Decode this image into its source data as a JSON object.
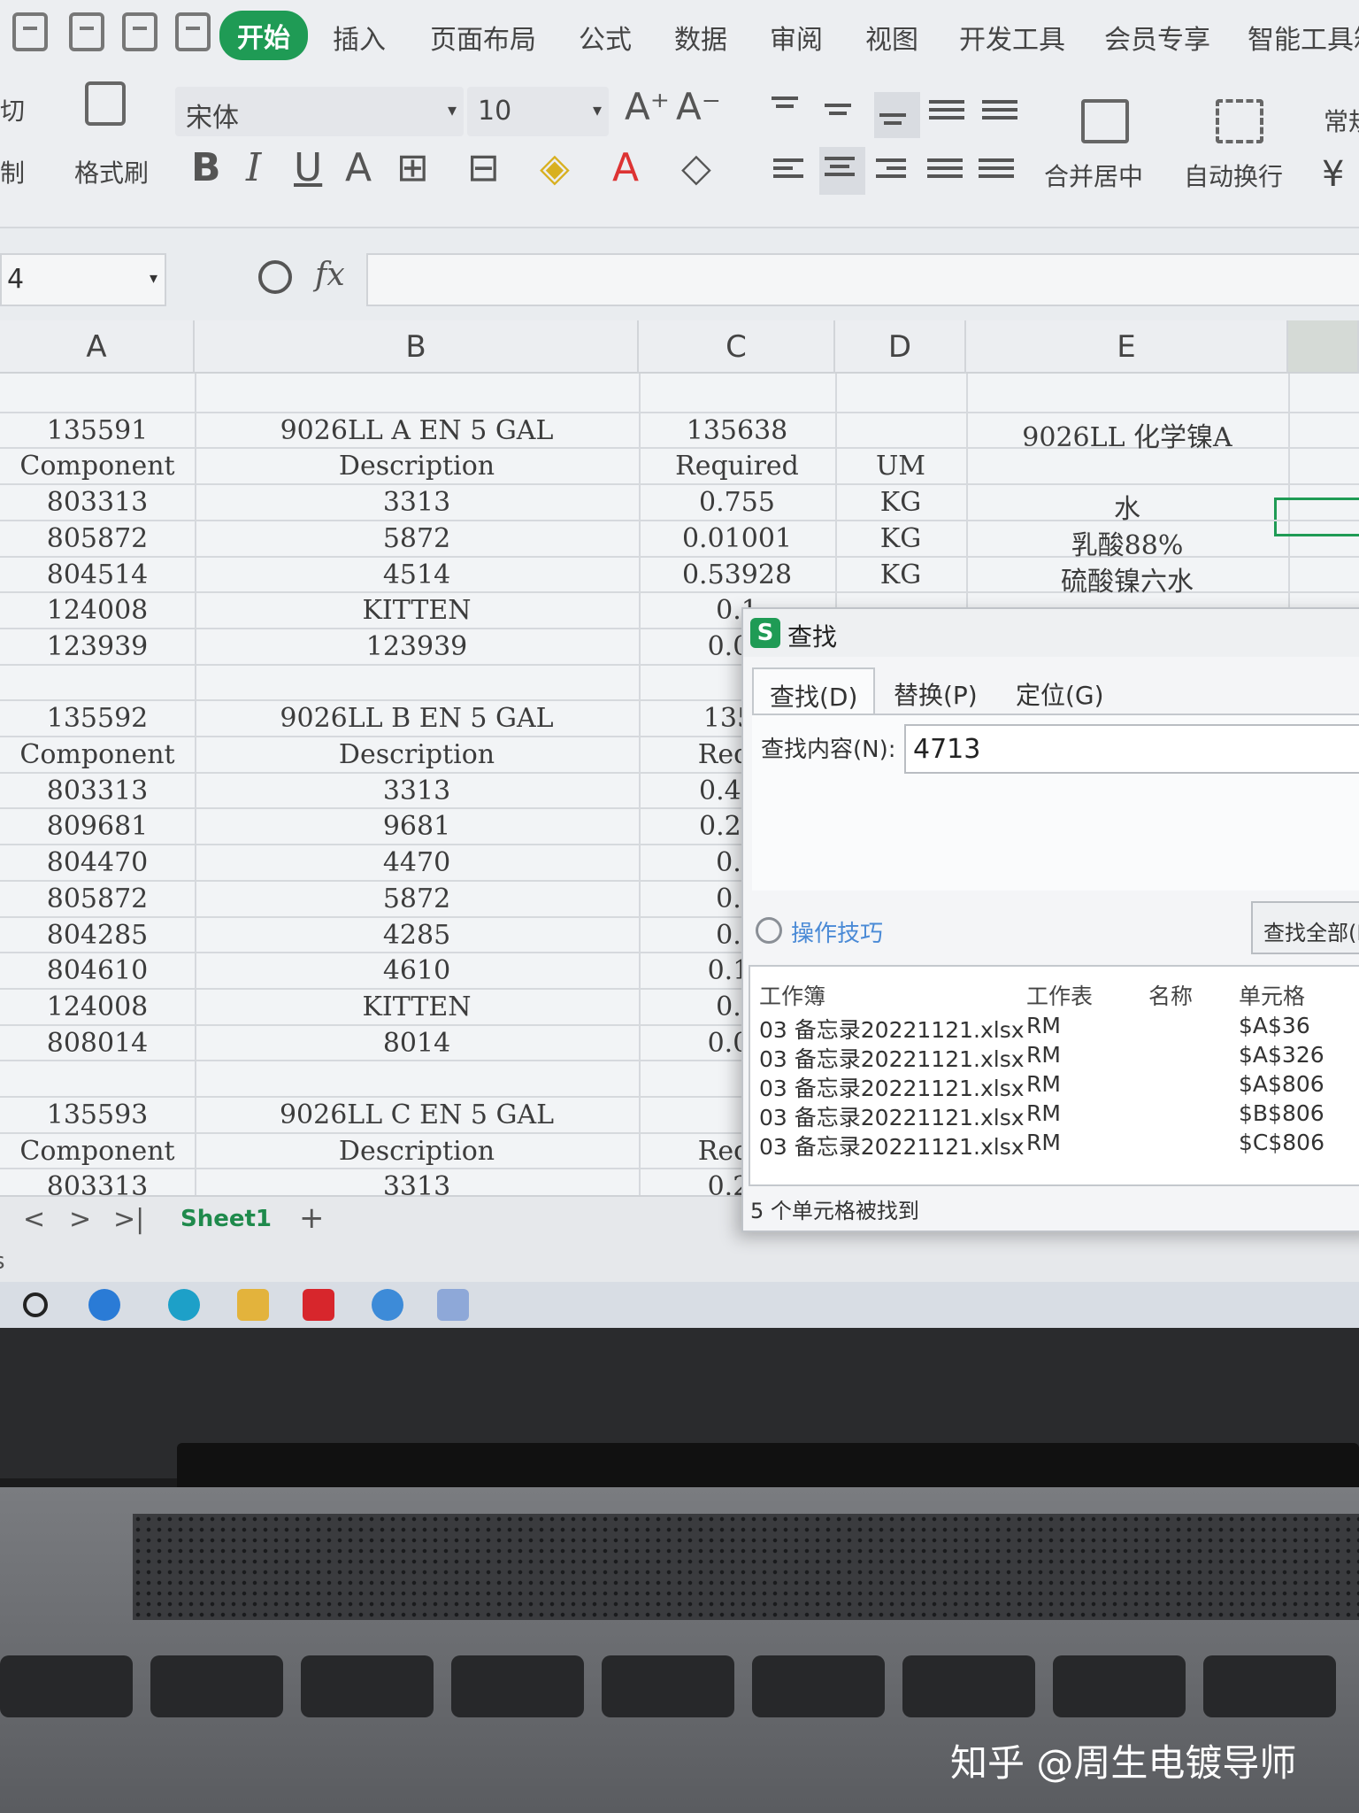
{
  "menu": {
    "tabs": [
      "开始",
      "插入",
      "页面布局",
      "公式",
      "数据",
      "审阅",
      "视图",
      "开发工具",
      "会员专享",
      "智能工具箱"
    ],
    "active_tab": "开始"
  },
  "ribbon": {
    "cut_label": "剪切",
    "copy_label": "复制",
    "format_painter_label": "格式刷",
    "font_name": "宋体",
    "font_size": "10",
    "merge_label": "合并居中",
    "wrap_label": "自动换行",
    "number_format": "常规",
    "currency_symbol": "¥"
  },
  "formula_bar": {
    "name_box": "4",
    "fx_label": "fx",
    "content": ""
  },
  "grid": {
    "columns": [
      "A",
      "B",
      "C",
      "D",
      "E"
    ],
    "rows": [
      {
        "a": "",
        "b": "",
        "c": "",
        "d": "",
        "e": ""
      },
      {
        "a": "135591",
        "b": "9026LL A EN 5 GAL",
        "c": "135638",
        "d": "",
        "e": "9026LL 化学镍A"
      },
      {
        "a": "Component",
        "b": "Description",
        "c": "Required",
        "d": "UM",
        "e": ""
      },
      {
        "a": "803313",
        "b": "3313",
        "c": "0.755",
        "d": "KG",
        "e": "水"
      },
      {
        "a": "805872",
        "b": "5872",
        "c": "0.01001",
        "d": "KG",
        "e": "乳酸88%"
      },
      {
        "a": "804514",
        "b": "4514",
        "c": "0.53928",
        "d": "KG",
        "e": "硫酸镍六水"
      },
      {
        "a": "124008",
        "b": "KITTEN",
        "c": "0.1",
        "d": "",
        "e": ""
      },
      {
        "a": "123939",
        "b": "123939",
        "c": "0.07",
        "d": "",
        "e": ""
      },
      {
        "a": "",
        "b": "",
        "c": "",
        "d": "",
        "e": ""
      },
      {
        "a": "135592",
        "b": "9026LL B EN 5 GAL",
        "c": "1356",
        "d": "",
        "e": ""
      },
      {
        "a": "Component",
        "b": "Description",
        "c": "Requi",
        "d": "",
        "e": ""
      },
      {
        "a": "803313",
        "b": "3313",
        "c": "0.442",
        "d": "",
        "e": ""
      },
      {
        "a": "809681",
        "b": "9681",
        "c": "0.283",
        "d": "",
        "e": ""
      },
      {
        "a": "804470",
        "b": "4470",
        "c": "0.0",
        "d": "",
        "e": ""
      },
      {
        "a": "805872",
        "b": "5872",
        "c": "0.1",
        "d": "",
        "e": ""
      },
      {
        "a": "804285",
        "b": "4285",
        "c": "0.0",
        "d": "",
        "e": ""
      },
      {
        "a": "804610",
        "b": "4610",
        "c": "0.19",
        "d": "",
        "e": ""
      },
      {
        "a": "124008",
        "b": "KITTEN",
        "c": "0.0",
        "d": "",
        "e": ""
      },
      {
        "a": "808014",
        "b": "8014",
        "c": "0.00",
        "d": "",
        "e": ""
      },
      {
        "a": "",
        "b": "",
        "c": "",
        "d": "",
        "e": ""
      },
      {
        "a": "135593",
        "b": "9026LL C EN 5 GAL",
        "c": "",
        "d": "",
        "e": ""
      },
      {
        "a": "Component",
        "b": "Description",
        "c": "Requi",
        "d": "",
        "e": ""
      },
      {
        "a": "803313",
        "b": "3313",
        "c": "0.26",
        "d": "",
        "e": ""
      }
    ]
  },
  "sheet_tabs": {
    "nav_first": "<",
    "nav_next": ">",
    "nav_last": ">|",
    "active_sheet": "Sheet1",
    "add": "+"
  },
  "status_char": "s",
  "find_dialog": {
    "title": "查找",
    "tabs": [
      "查找(D)",
      "替换(P)",
      "定位(G)"
    ],
    "search_label": "查找内容(N):",
    "search_value": "4713",
    "tips_label": "操作技巧",
    "find_all_button": "查找全部(I)",
    "columns": [
      "工作簿",
      "工作表",
      "名称",
      "单元格"
    ],
    "results": [
      {
        "workbook": "03 备忘录20221121.xlsx",
        "sheet": "RM",
        "name": "",
        "cell": "$A$36"
      },
      {
        "workbook": "03 备忘录20221121.xlsx",
        "sheet": "RM",
        "name": "",
        "cell": "$A$326"
      },
      {
        "workbook": "03 备忘录20221121.xlsx",
        "sheet": "RM",
        "name": "",
        "cell": "$A$806"
      },
      {
        "workbook": "03 备忘录20221121.xlsx",
        "sheet": "RM",
        "name": "",
        "cell": "$B$806"
      },
      {
        "workbook": "03 备忘录20221121.xlsx",
        "sheet": "RM",
        "name": "",
        "cell": "$C$806"
      }
    ],
    "status": "5 个单元格被找到"
  },
  "watermark": "知乎 @周生电镀导师"
}
